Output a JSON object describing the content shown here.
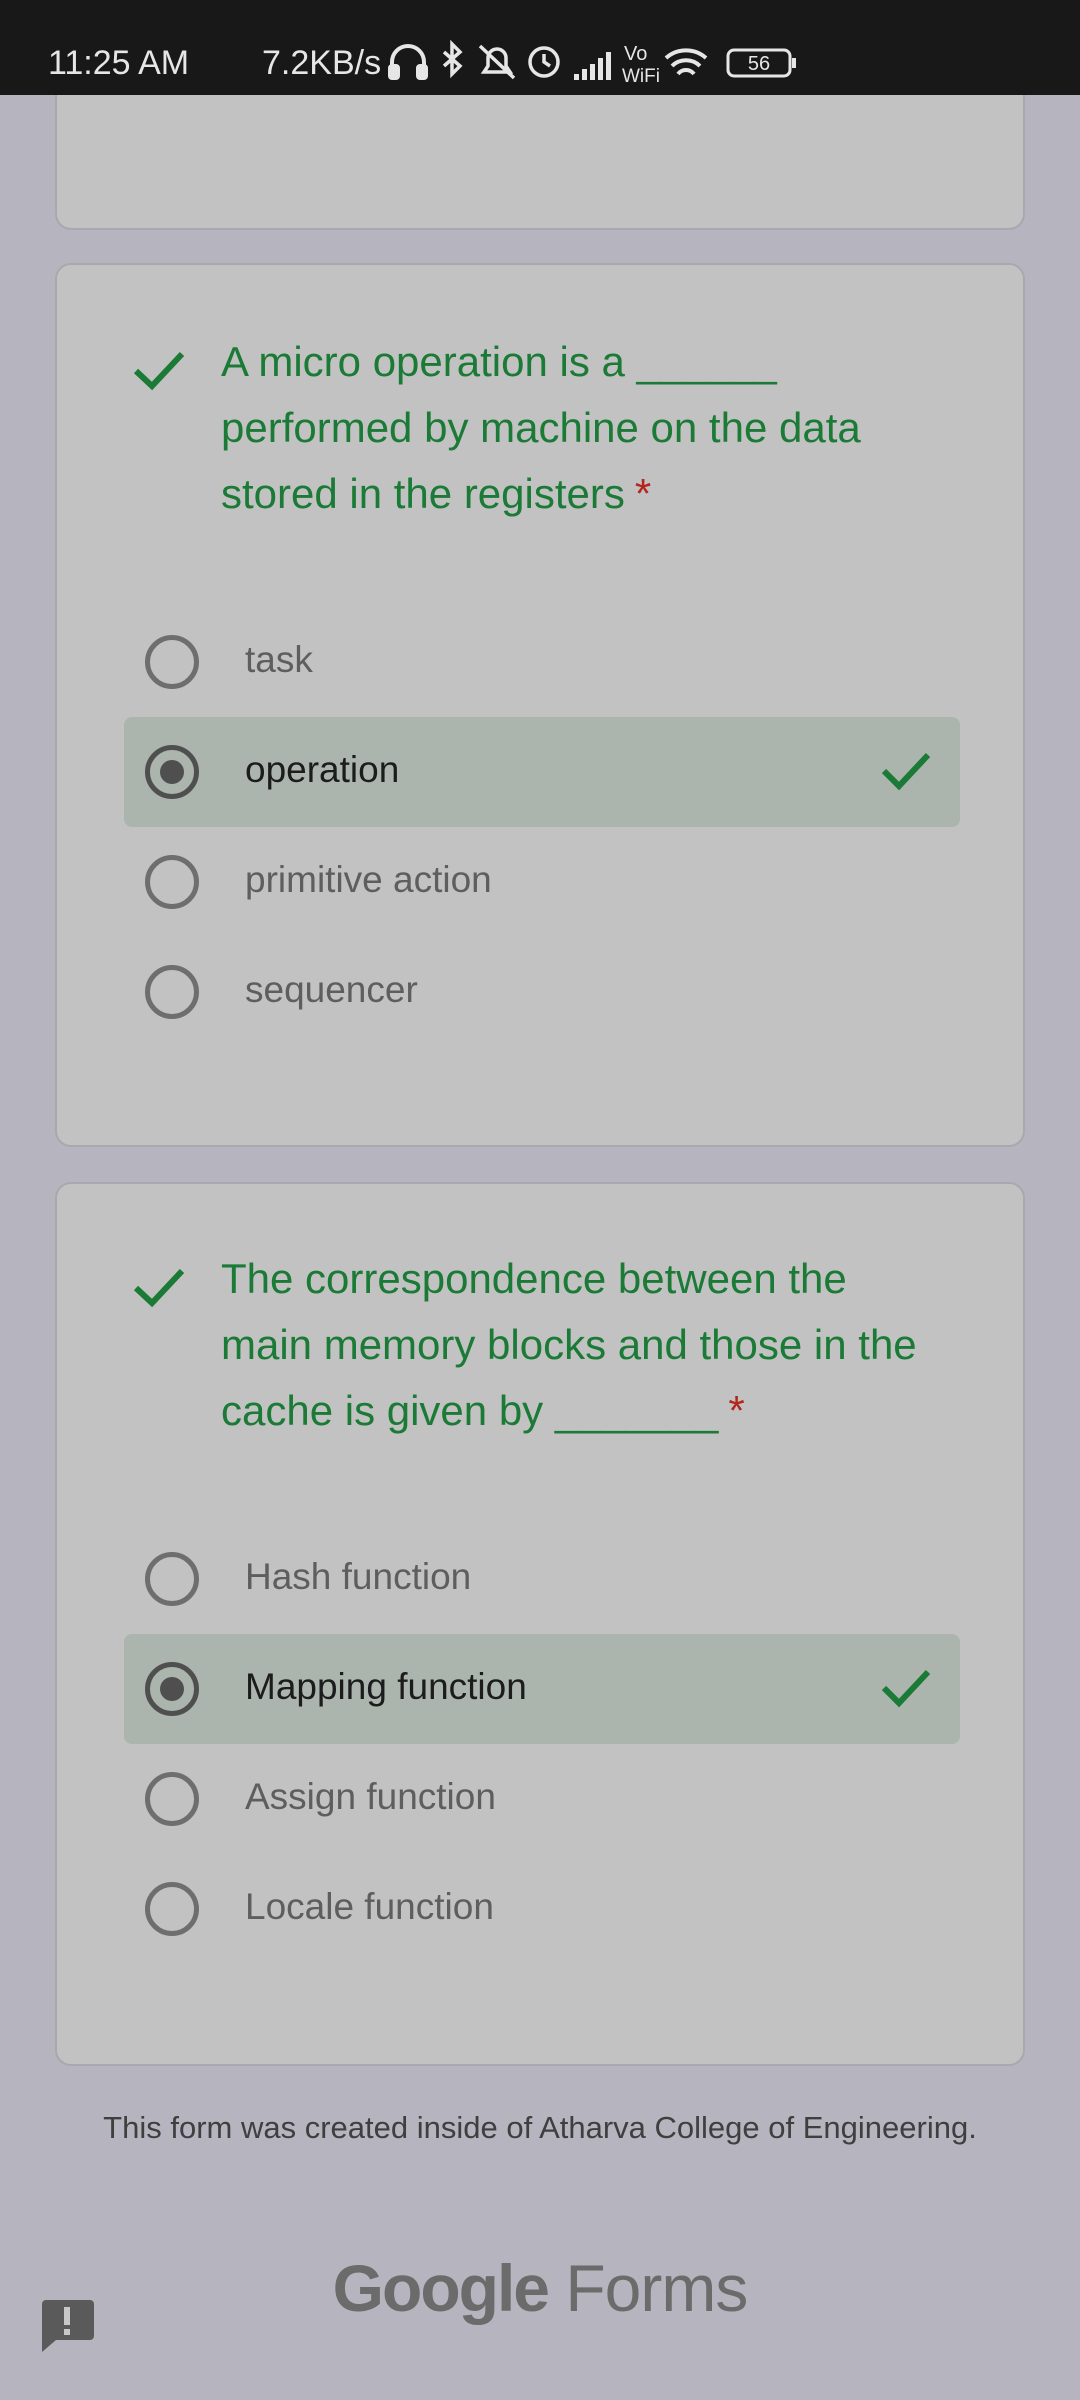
{
  "status_bar": {
    "time": "11:25 AM",
    "net_speed": "7.2KB/s",
    "icons": [
      "headphones-icon",
      "bluetooth-icon",
      "mute-icon",
      "alarm-icon",
      "signal-icon",
      "vowifi-icon",
      "wifi-icon",
      "battery-icon"
    ],
    "vowifi_top": "Vo",
    "vowifi_bottom": "WiFi",
    "battery_level": "56"
  },
  "questions": [
    {
      "title": "A micro operation is a ______ performed by machine on the data stored in the registers",
      "required": "*",
      "correct": true,
      "options": [
        {
          "label": "task",
          "selected": false
        },
        {
          "label": "operation",
          "selected": true,
          "correct": true
        },
        {
          "label": "primitive action",
          "selected": false
        },
        {
          "label": "sequencer",
          "selected": false
        }
      ]
    },
    {
      "title": "The correspondence between the main memory blocks and those in the cache is given by _______",
      "required": "*",
      "correct": true,
      "options": [
        {
          "label": "Hash function",
          "selected": false
        },
        {
          "label": "Mapping function",
          "selected": true,
          "correct": true
        },
        {
          "label": "Assign function",
          "selected": false
        },
        {
          "label": "Locale function",
          "selected": false
        }
      ]
    }
  ],
  "footer": {
    "note": "This form was created inside of Atharva College of Engineering.",
    "logo_google": "Google",
    "logo_forms": "Forms"
  },
  "colors": {
    "correct_green": "#1a7a36",
    "required_red": "#b3261e",
    "selected_bg": "#abb5ae"
  }
}
